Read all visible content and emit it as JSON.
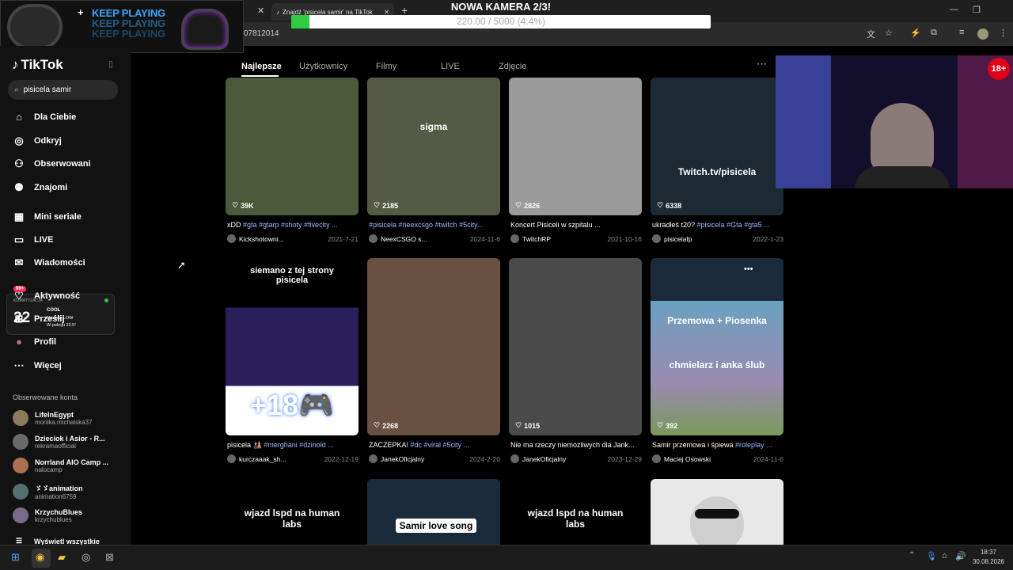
{
  "browser": {
    "tab_title": "Znajdź 'pisicela samir' na TikTok",
    "url_fragment": "07812014"
  },
  "overlay": {
    "promo_text": "KEEP PLAYING",
    "camera_title": "NOWA KAMERA 2/3!",
    "camera_progress_text": "220.00 / 5000 (4.4%)",
    "camera_progress": 0.044,
    "age_badge": "18+"
  },
  "sidebar": {
    "logo": "TikTok",
    "search_value": "pisicela samir",
    "nav": [
      {
        "label": "Dla Ciebie",
        "icon": "home-icon"
      },
      {
        "label": "Odkryj",
        "icon": "compass-icon"
      },
      {
        "label": "Obserwowani",
        "icon": "following-icon"
      },
      {
        "label": "Znajomi",
        "icon": "friends-icon"
      },
      {
        "label": "Mini seriale",
        "icon": "film-icon"
      },
      {
        "label": "LIVE",
        "icon": "live-icon"
      },
      {
        "label": "Wiadomości",
        "icon": "message-icon"
      },
      {
        "label": "Aktywność",
        "icon": "activity-icon"
      },
      {
        "label": "Prześlij",
        "icon": "upload-icon"
      },
      {
        "label": "Profil",
        "icon": "profile-icon"
      },
      {
        "label": "Więcej",
        "icon": "more-icon"
      }
    ],
    "activity_badge": "99+",
    "followed_header": "Obserwowane konta",
    "accounts": [
      {
        "name": "LifeInEgypt",
        "handle": "monika.michalska37"
      },
      {
        "name": "Dzieciok i Asior - R...",
        "handle": "rekramaofficial"
      },
      {
        "name": "Norrland AIO Camp ...",
        "handle": "nalocamp"
      },
      {
        "name": "ゞゞanimation",
        "handle": "animation6759"
      },
      {
        "name": "KrzychuBlues",
        "handle": "krzychublues"
      }
    ],
    "show_all": "Wyświetl wszystkie"
  },
  "climate_widget": {
    "label": "KLIMATYZACJA",
    "temp": "22",
    "mode": "COOL",
    "fan": "Nawiew LOW",
    "room": "W pokoju 23.5°"
  },
  "content_tabs": [
    "Najlepsze",
    "Użytkownicy",
    "Filmy",
    "LIVE",
    "Zdjęcie"
  ],
  "videos": [
    {
      "likes": "39K",
      "desc_plain": "xDD ",
      "desc_tags": "#gta #gtarp #shoty #fivecity ...",
      "user": "Kickshotowni...",
      "date": "2021-7-21",
      "overlay": "",
      "color": "#4a5a3a"
    },
    {
      "likes": "2185",
      "desc_plain": "",
      "desc_tags": "#pisicela #neexcsgo #twitch #5city...",
      "user": "NeexCSGO s...",
      "date": "2024-11-6",
      "overlay": "sigma",
      "color": "#555a45"
    },
    {
      "likes": "2826",
      "desc_plain": "Koncert Pisiceli w szpitalu ...",
      "desc_tags": "",
      "user": "TwitchRP",
      "date": "2021-10-16",
      "overlay": "",
      "color": "#9a9a9a"
    },
    {
      "likes": "6338",
      "desc_plain": "ukradłeś t20? ",
      "desc_tags": "#pisicela #Gta #gta5 ...",
      "user": "pisicelafp",
      "date": "2022-1-23",
      "overlay": "Twitch.tv/pisicela",
      "color": "#1d2a33"
    },
    {
      "likes": "89",
      "desc_plain": "pisicela 🎎 ",
      "desc_tags": "#merghani #dzinold ...",
      "user": "kurczaaak_sh...",
      "date": "2022-12-19",
      "overlay": "siemano z tej strony pisicela",
      "overlay2": "+18🎮",
      "color": "#2a1f5a"
    },
    {
      "likes": "2268",
      "desc_plain": "ZACZEPKA! ",
      "desc_tags": "#dc #viral #5city ...",
      "user": "JanekOficjalny",
      "date": "2024-2-20",
      "overlay": "",
      "color": "#6a5040"
    },
    {
      "likes": "1015",
      "desc_plain": "Nie ma rzeczy niemożliwych dla Jank...",
      "desc_tags": "",
      "user": "JanekOficjalny",
      "date": "2023-12-29",
      "overlay": "",
      "color": "#4a4a4a"
    },
    {
      "likes": "392",
      "desc_plain": "Samir przemowa i śpiewa ",
      "desc_tags": "#roleplay ...",
      "user": "Maciej Osowski",
      "date": "2024-11-6",
      "overlay": "Przemowa + Piosenka",
      "overlay2": "chmielarz i anka ślub",
      "color": "#3a5a7a"
    }
  ],
  "row3": [
    {
      "overlay": "wjazd lspd na human labs",
      "color": "#000000"
    },
    {
      "overlay": "Samir love song",
      "color": "#1a2a3a"
    },
    {
      "overlay": "wjazd lspd na human labs",
      "color": "#000000"
    },
    {
      "overlay": "",
      "color": "#e8e8e8"
    }
  ],
  "taskbar": {
    "time": "18:37",
    "date": "30.08.2026"
  }
}
